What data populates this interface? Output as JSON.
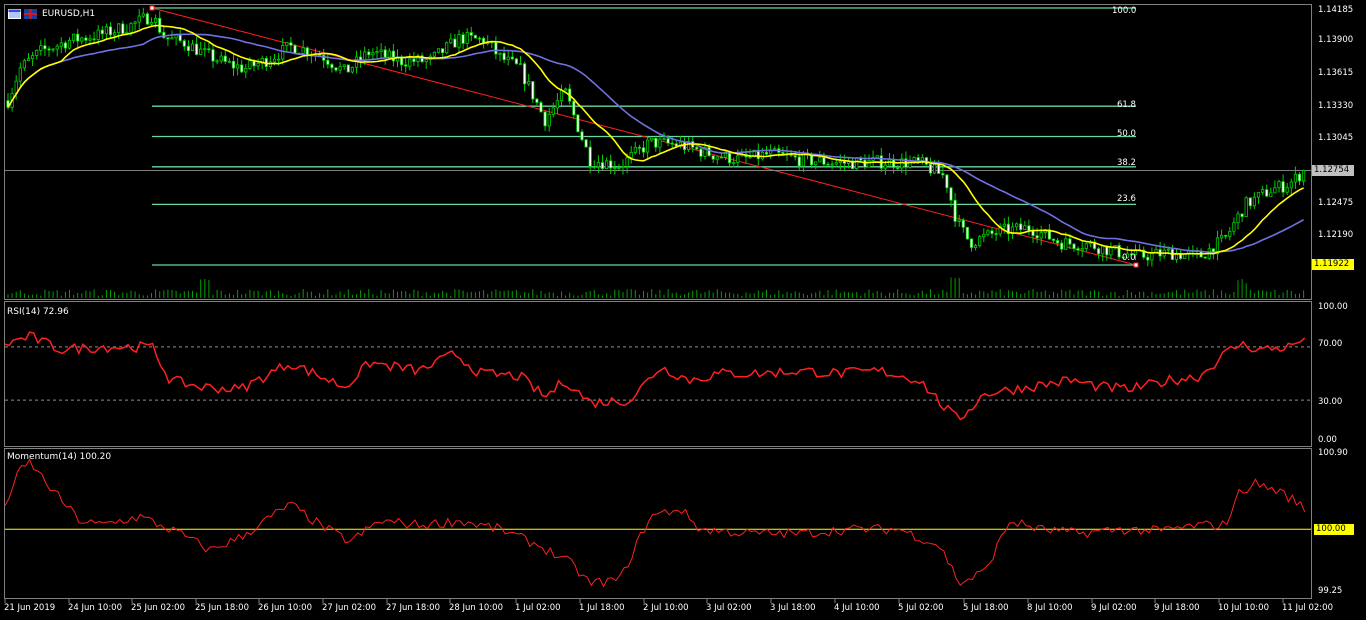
{
  "header": {
    "symbol": "EURUSD,H1",
    "rsi_label": "RSI(14) 72.96",
    "momentum_label": "Momentum(14) 100.20"
  },
  "icons": [
    "chart-window-icon",
    "flag-icon"
  ],
  "price_axis": {
    "labels": [
      "1.14185",
      "1.13900",
      "1.13615",
      "1.13330",
      "1.13045",
      "1.12475",
      "1.12190"
    ],
    "current_price": "1.12754",
    "low_price": "1.11922"
  },
  "fibonacci": {
    "levels": [
      "100.0",
      "61.8",
      "50.0",
      "38.2",
      "23.6",
      "0.0"
    ]
  },
  "rsi_axis": {
    "labels": [
      "100.00",
      "70.00",
      "30.00",
      "0.00"
    ]
  },
  "momentum_axis": {
    "labels": [
      "100.90",
      "100.00",
      "99.25"
    ]
  },
  "time_axis": {
    "labels": [
      "21 Jun 2019",
      "24 Jun 10:00",
      "25 Jun 02:00",
      "25 Jun 18:00",
      "26 Jun 10:00",
      "27 Jun 02:00",
      "27 Jun 18:00",
      "28 Jun 10:00",
      "1 Jul 02:00",
      "1 Jul 18:00",
      "2 Jul 10:00",
      "3 Jul 02:00",
      "3 Jul 18:00",
      "4 Jul 10:00",
      "5 Jul 02:00",
      "5 Jul 18:00",
      "8 Jul 10:00",
      "9 Jul 02:00",
      "9 Jul 18:00",
      "10 Jul 10:00",
      "11 Jul 02:00"
    ]
  },
  "colors": {
    "candle": "#00d000",
    "ma_fast": "#ffff00",
    "ma_slow": "#7070e0",
    "fib": "#66d9a0",
    "trend": "#ff2020",
    "rsi": "#ff2020",
    "momentum": "#ff2020",
    "momentum_level": "#ffff00",
    "volume": "#00a000"
  },
  "chart_data": {
    "type": "line",
    "x": [
      "21 Jun 2019",
      "24 Jun 10:00",
      "25 Jun 02:00",
      "25 Jun 18:00",
      "26 Jun 10:00",
      "27 Jun 02:00",
      "27 Jun 18:00",
      "28 Jun 10:00",
      "1 Jul 02:00",
      "1 Jul 18:00",
      "2 Jul 10:00",
      "3 Jul 02:00",
      "3 Jul 18:00",
      "4 Jul 10:00",
      "5 Jul 02:00",
      "5 Jul 18:00",
      "8 Jul 10:00",
      "9 Jul 02:00",
      "9 Jul 18:00",
      "10 Jul 10:00",
      "11 Jul 02:00"
    ],
    "series": [
      {
        "name": "EURUSD,H1",
        "values": [
          1.1368,
          1.1392,
          1.1412,
          1.1378,
          1.1368,
          1.1372,
          1.137,
          1.1382,
          1.1342,
          1.1284,
          1.1296,
          1.1292,
          1.129,
          1.1284,
          1.1272,
          1.1212,
          1.1218,
          1.1202,
          1.1204,
          1.1244,
          1.1275
        ]
      },
      {
        "name": "RSI(14)",
        "values": [
          72,
          70,
          68,
          42,
          45,
          55,
          52,
          55,
          35,
          28,
          48,
          50,
          52,
          50,
          50,
          18,
          40,
          40,
          45,
          62,
          73
        ]
      },
      {
        "name": "Momentum(14)",
        "values": [
          100.5,
          100.1,
          100.0,
          99.75,
          99.95,
          100.05,
          100.0,
          100.05,
          99.8,
          99.5,
          100.1,
          100.0,
          99.95,
          100.0,
          100.0,
          99.4,
          100.05,
          99.95,
          100.0,
          100.05,
          100.2
        ]
      }
    ],
    "ylim": [
      1.1192,
      1.14185
    ]
  }
}
